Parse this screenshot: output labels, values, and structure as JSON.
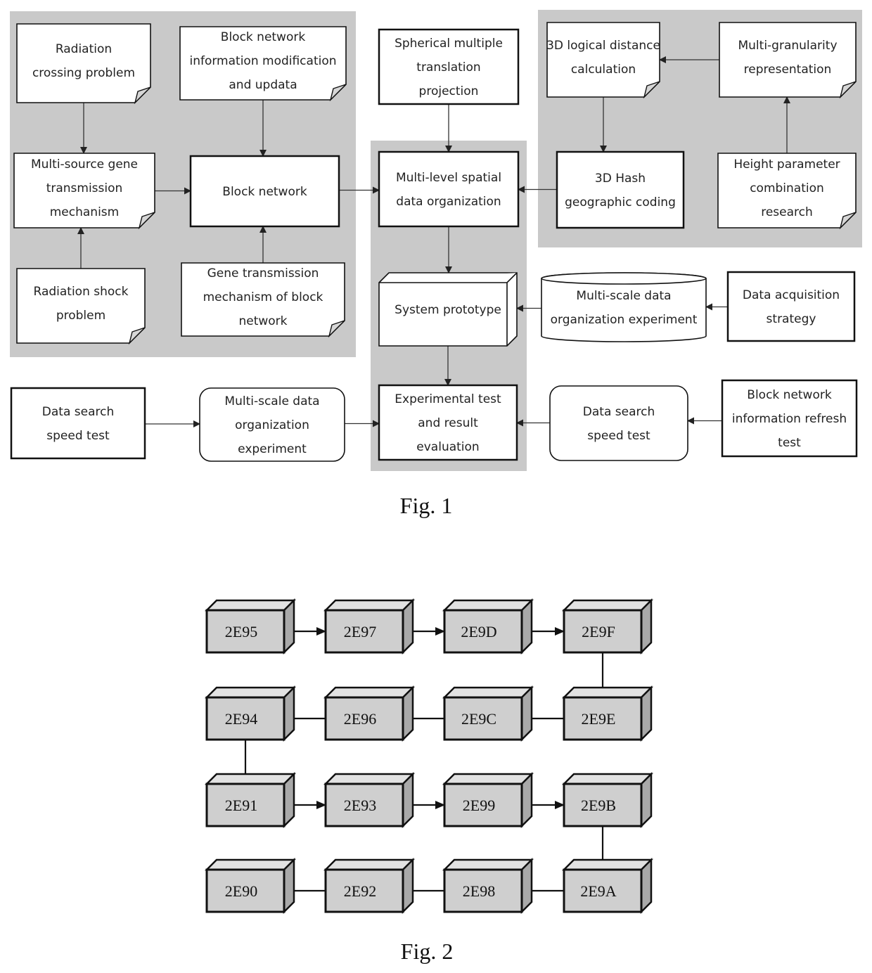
{
  "fig1": {
    "caption": "Fig. 1",
    "nodes": {
      "radiation_crossing": [
        "Radiation",
        "crossing problem"
      ],
      "block_info_mod": [
        "Block network",
        "information modification",
        "and updata"
      ],
      "spherical": [
        "Spherical multiple",
        "translation",
        "projection"
      ],
      "logical_distance": [
        "3D logical distance",
        "calculation"
      ],
      "multi_granularity": [
        "Multi-granularity",
        "representation"
      ],
      "multi_source": [
        "Multi-source gene",
        "transmission",
        "mechanism"
      ],
      "block_network": [
        "Block network"
      ],
      "multi_level": [
        "Multi-level spatial",
        "data organization"
      ],
      "hash_coding": [
        "3D Hash",
        "geographic coding"
      ],
      "height_param": [
        "Height parameter",
        "combination",
        "research"
      ],
      "radiation_shock": [
        "Radiation shock",
        "problem"
      ],
      "gene_transmission": [
        "Gene transmission",
        "mechanism of block",
        "network"
      ],
      "system_prototype": [
        "System prototype"
      ],
      "multiscale_cyl": [
        "Multi-scale data",
        "organization experiment"
      ],
      "data_acq": [
        "Data acquisition",
        "strategy"
      ],
      "search_left": [
        "Data search",
        "speed test"
      ],
      "multiscale_round": [
        "Multi-scale data",
        "organization",
        "experiment"
      ],
      "experimental": [
        "Experimental test",
        "and result",
        "evaluation"
      ],
      "search_right": [
        "Data search",
        "speed test"
      ],
      "refresh_test": [
        "Block network",
        "information refresh",
        "test"
      ]
    },
    "edges": [
      [
        "radiation_crossing",
        "multi_source"
      ],
      [
        "radiation_shock",
        "multi_source"
      ],
      [
        "block_info_mod",
        "block_network"
      ],
      [
        "gene_transmission",
        "block_network"
      ],
      [
        "multi_source",
        "block_network"
      ],
      [
        "block_network",
        "multi_level"
      ],
      [
        "spherical",
        "multi_level"
      ],
      [
        "hash_coding",
        "multi_level"
      ],
      [
        "multi_granularity",
        "logical_distance"
      ],
      [
        "logical_distance",
        "hash_coding"
      ],
      [
        "height_param",
        "multi_granularity"
      ],
      [
        "multi_level",
        "system_prototype"
      ],
      [
        "multiscale_cyl",
        "system_prototype"
      ],
      [
        "data_acq",
        "multiscale_cyl"
      ],
      [
        "system_prototype",
        "experimental"
      ],
      [
        "search_left",
        "multiscale_round"
      ],
      [
        "multiscale_round",
        "experimental"
      ],
      [
        "search_right",
        "experimental"
      ],
      [
        "refresh_test",
        "search_right"
      ]
    ]
  },
  "fig2": {
    "caption": "Fig. 2",
    "rows": [
      [
        "2E95",
        "2E97",
        "2E9D",
        "2E9F"
      ],
      [
        "2E94",
        "2E96",
        "2E9C",
        "2E9E"
      ],
      [
        "2E91",
        "2E93",
        "2E99",
        "2E9B"
      ],
      [
        "2E90",
        "2E92",
        "2E98",
        "2E9A"
      ]
    ],
    "path": [
      "2E95",
      "2E97",
      "2E9D",
      "2E9F",
      "2E9E",
      "2E9C",
      "2E96",
      "2E94",
      "2E91",
      "2E93",
      "2E99",
      "2E9B",
      "2E9A",
      "2E98",
      "2E92",
      "2E90"
    ]
  }
}
